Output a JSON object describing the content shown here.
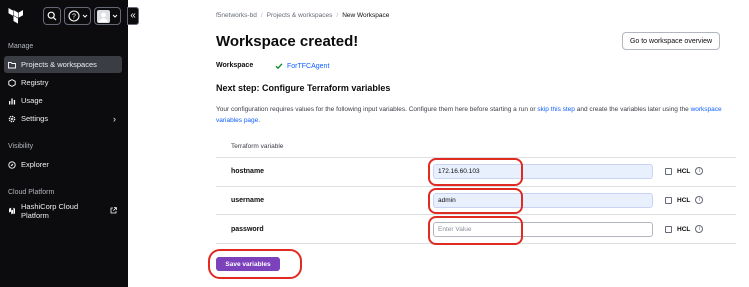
{
  "sidebar": {
    "logo": "terraform-logo",
    "icons": [
      "search-icon",
      "help-icon",
      "user-avatar-icon"
    ],
    "sections": [
      {
        "label": "Manage",
        "items": [
          {
            "label": "Projects & workspaces",
            "icon": "folder-icon",
            "active": true
          },
          {
            "label": "Registry",
            "icon": "registry-icon"
          },
          {
            "label": "Usage",
            "icon": "usage-icon"
          },
          {
            "label": "Settings",
            "icon": "gear-icon",
            "chevron": "›"
          }
        ]
      },
      {
        "label": "Visibility",
        "items": [
          {
            "label": "Explorer",
            "icon": "explorer-icon"
          }
        ]
      },
      {
        "label": "Cloud Platform",
        "items": [
          {
            "label": "HashiCorp Cloud Platform",
            "icon": "hashicorp-icon",
            "external": true
          }
        ]
      }
    ],
    "collapse_glyph": "«"
  },
  "breadcrumb": [
    "f5networks-bd",
    "Projects & workspaces",
    "New Workspace"
  ],
  "breadcrumb_sep": "/",
  "page_title": "Workspace created!",
  "goto_button": "Go to workspace overview",
  "workspace": {
    "label": "Workspace",
    "name": "ForTFCAgent"
  },
  "next_step": "Next step: Configure Terraform variables",
  "description": {
    "part1": "Your configuration requires values for the following input variables. Configure them here before starting a run or ",
    "link1": "skip this step",
    "part2": " and create the variables later using the ",
    "link2": "workspace variables page",
    "part3": "."
  },
  "table_header": "Terraform variable",
  "variables": [
    {
      "name": "hostname",
      "value": "172.16.60.103",
      "placeholder": "",
      "hcl_label": "HCL",
      "hcl_checked": false
    },
    {
      "name": "username",
      "value": "admin",
      "placeholder": "",
      "hcl_label": "HCL",
      "hcl_checked": false
    },
    {
      "name": "password",
      "value": "",
      "placeholder": "Enter Value",
      "hcl_label": "HCL",
      "hcl_checked": false
    }
  ],
  "info_glyph": "i",
  "save_button": "Save variables",
  "colors": {
    "sidebar_bg": "#0c0c0e",
    "primary": "#7b42bc",
    "link": "#1060ff",
    "highlight": "#e02b22",
    "success": "#008a22"
  }
}
